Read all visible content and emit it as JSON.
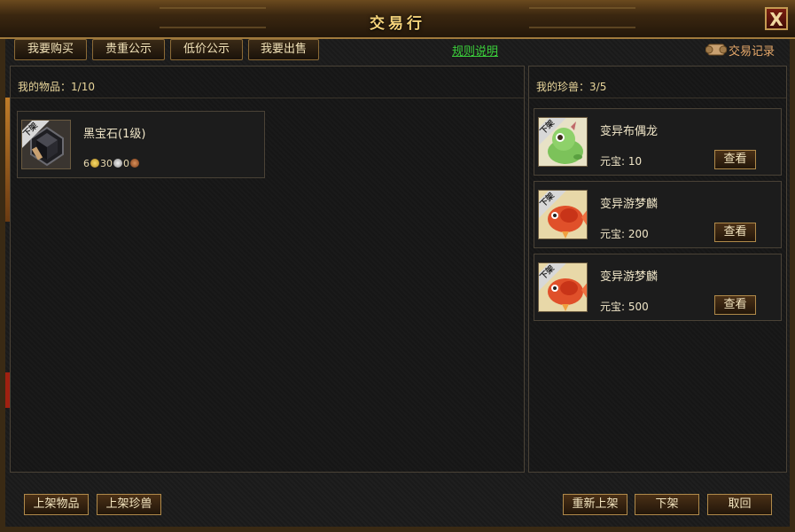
{
  "window": {
    "title": "交易行",
    "close_label": "X"
  },
  "tabs": [
    {
      "label": "我要购买"
    },
    {
      "label": "贵重公示"
    },
    {
      "label": "低价公示"
    },
    {
      "label": "我要出售"
    }
  ],
  "rules_link": "规则说明",
  "trade_record": {
    "label": "交易记录",
    "icon": "scroll-icon"
  },
  "my_items": {
    "header_label": "我的物品：",
    "count": "1/10",
    "items": [
      {
        "name": "黑宝石(1级)",
        "tag": "下架",
        "icon": "black-gem-icon",
        "gold": "6",
        "silver": "30",
        "copper": "0"
      }
    ]
  },
  "my_pets": {
    "header_label": "我的珍兽：",
    "count": "3/5",
    "pets": [
      {
        "name": "变异布偶龙",
        "tag": "下架",
        "price_label": "元宝:",
        "price": "10",
        "view_label": "查看",
        "icon": "green-dragon-icon"
      },
      {
        "name": "变异游梦麟",
        "tag": "下架",
        "price_label": "元宝:",
        "price": "200",
        "view_label": "查看",
        "icon": "red-fish-icon"
      },
      {
        "name": "变异游梦麟",
        "tag": "下架",
        "price_label": "元宝:",
        "price": "500",
        "view_label": "查看",
        "icon": "red-fish-icon"
      }
    ]
  },
  "bottom_buttons": {
    "list_item": "上架物品",
    "list_pet": "上架珍兽",
    "relist": "重新上架",
    "delist": "下架",
    "cancel": "取回"
  },
  "colors": {
    "title": "#f4d27a",
    "rules_link": "#3bd13b",
    "trade_record": "#e6a86a",
    "gold_coin": "#e2b436",
    "silver_coin": "#c8c8c8",
    "copper_coin": "#b0683a"
  }
}
